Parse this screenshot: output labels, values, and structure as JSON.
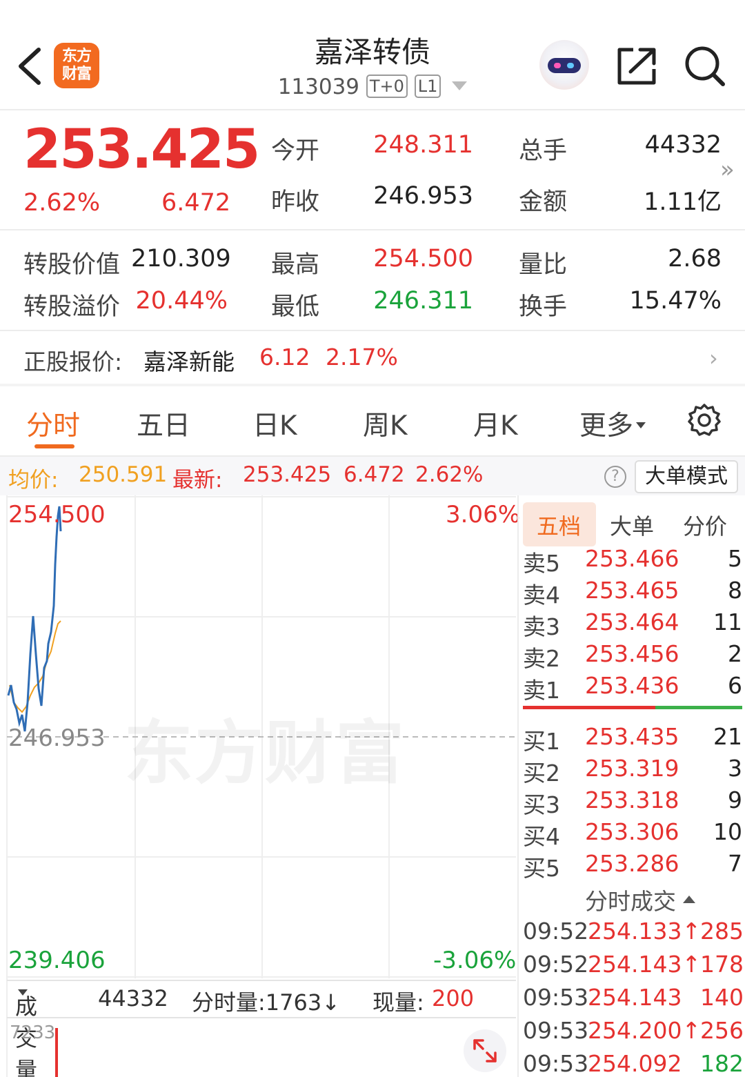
{
  "header": {
    "logo_text_line1": "东方",
    "logo_text_line2": "财富",
    "title": "嘉泽转债",
    "code": "113039",
    "tag_t0": "T+0",
    "tag_level": "L1"
  },
  "quote": {
    "price": "253.425",
    "change_pct": "2.62%",
    "change": "6.472",
    "open_label": "今开",
    "open": "248.311",
    "prev_close_label": "昨收",
    "prev_close": "246.953",
    "volume_label": "总手",
    "volume": "44332",
    "amount_label": "金额",
    "amount": "1.11亿",
    "conv_value_label": "转股价值",
    "conv_value": "210.309",
    "conv_premium_label": "转股溢价",
    "conv_premium": "20.44%",
    "high_label": "最高",
    "high": "254.500",
    "low_label": "最低",
    "low": "246.311",
    "vol_ratio_label": "量比",
    "vol_ratio": "2.68",
    "turnover_label": "换手",
    "turnover": "15.47%"
  },
  "underlying": {
    "label": "正股报价:",
    "name": "嘉泽新能",
    "price": "6.12",
    "pct": "2.17%"
  },
  "tabs": [
    "分时",
    "五日",
    "日K",
    "周K",
    "月K",
    "更多"
  ],
  "infobar": {
    "avg_label": "均价:",
    "avg": "250.591",
    "latest_label": "最新:",
    "latest": "253.425",
    "latest_chg": "6.472",
    "latest_pct": "2.62%",
    "help": "?",
    "bigorder_btn": "大单模式"
  },
  "chart": {
    "max_label": "254.500",
    "max_pct": "3.06%",
    "mid_label": "246.953",
    "min_label": "239.406",
    "min_pct": "-3.06%",
    "watermark": "东方财富"
  },
  "volume_bar": {
    "label": "成交量",
    "total": "44332",
    "minute_vol": "分时量:1763↓",
    "current_label": "现量:",
    "current": "200",
    "axis_max": "7233"
  },
  "book": {
    "tabs": [
      "五档",
      "大单",
      "分价"
    ],
    "asks": [
      {
        "k": "卖5",
        "p": "253.466",
        "v": "5"
      },
      {
        "k": "卖4",
        "p": "253.465",
        "v": "8"
      },
      {
        "k": "卖3",
        "p": "253.464",
        "v": "11"
      },
      {
        "k": "卖2",
        "p": "253.456",
        "v": "2"
      },
      {
        "k": "卖1",
        "p": "253.436",
        "v": "6"
      }
    ],
    "bids": [
      {
        "k": "买1",
        "p": "253.435",
        "v": "21"
      },
      {
        "k": "买2",
        "p": "253.319",
        "v": "3"
      },
      {
        "k": "买3",
        "p": "253.318",
        "v": "9"
      },
      {
        "k": "买4",
        "p": "253.306",
        "v": "10"
      },
      {
        "k": "买5",
        "p": "253.286",
        "v": "7"
      }
    ],
    "ticks_title": "分时成交",
    "ticks": [
      {
        "t": "09:52",
        "p": "254.133↑",
        "v": "285"
      },
      {
        "t": "09:52",
        "p": "254.143↑",
        "v": "178"
      },
      {
        "t": "09:53",
        "p": "254.143",
        "v": "140"
      },
      {
        "t": "09:53",
        "p": "254.200↑",
        "v": "256"
      },
      {
        "t": "09:53",
        "p": "254.092",
        "v": "182"
      }
    ]
  },
  "colors": {
    "red": "#e5312f",
    "green": "#1aa33b",
    "accent": "#f06a1f",
    "avg_line": "#f0a020",
    "price_line": "#2f6db5"
  }
}
